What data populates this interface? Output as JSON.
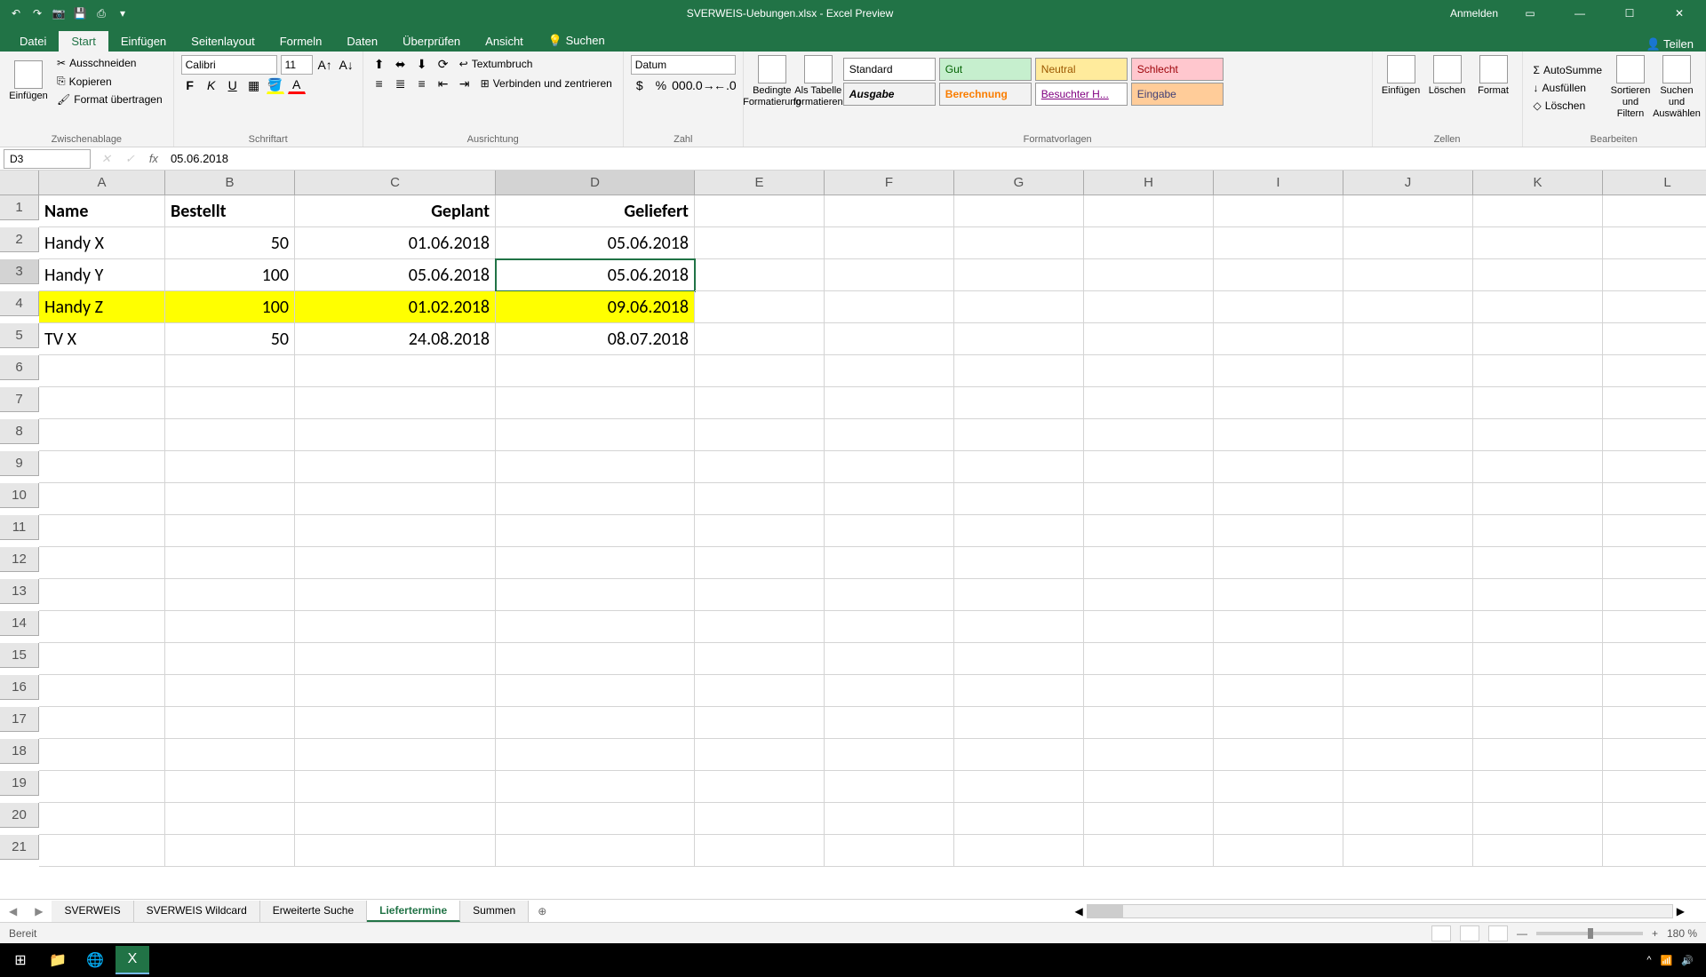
{
  "titlebar": {
    "title": "SVERWEIS-Uebungen.xlsx - Excel Preview",
    "login": "Anmelden"
  },
  "menutabs": {
    "items": [
      "Datei",
      "Start",
      "Einfügen",
      "Seitenlayout",
      "Formeln",
      "Daten",
      "Überprüfen",
      "Ansicht"
    ],
    "active": 1,
    "search": "Suchen",
    "share": "Teilen"
  },
  "ribbon": {
    "clipboard": {
      "paste": "Einfügen",
      "cut": "Ausschneiden",
      "copy": "Kopieren",
      "format_painter": "Format übertragen",
      "label": "Zwischenablage"
    },
    "font": {
      "name": "Calibri",
      "size": "11",
      "label": "Schriftart"
    },
    "alignment": {
      "wrap": "Textumbruch",
      "merge": "Verbinden und zentrieren",
      "label": "Ausrichtung"
    },
    "number": {
      "format": "Datum",
      "label": "Zahl"
    },
    "styles": {
      "cond": "Bedingte Formatierung",
      "table": "Als Tabelle formatieren",
      "standard": "Standard",
      "gut": "Gut",
      "neutral": "Neutral",
      "schlecht": "Schlecht",
      "ausgabe": "Ausgabe",
      "berechnung": "Berechnung",
      "besuchter": "Besuchter H...",
      "eingabe": "Eingabe",
      "label": "Formatvorlagen"
    },
    "cells": {
      "insert": "Einfügen",
      "delete": "Löschen",
      "format": "Format",
      "label": "Zellen"
    },
    "editing": {
      "autosum": "AutoSumme",
      "fill": "Ausfüllen",
      "clear": "Löschen",
      "sort": "Sortieren und Filtern",
      "find": "Suchen und Auswählen",
      "label": "Bearbeiten"
    }
  },
  "formulabar": {
    "namebox": "D3",
    "value": "05.06.2018"
  },
  "grid": {
    "columns": [
      "A",
      "B",
      "C",
      "D",
      "E",
      "F",
      "G",
      "H",
      "I",
      "J",
      "K",
      "L"
    ],
    "selected_col": "D",
    "selected_row": 3,
    "highlighted_row": 4,
    "headers": [
      "Name",
      "Bestellt",
      "Geplant",
      "Geliefert"
    ],
    "rows": [
      {
        "name": "Handy X",
        "bestellt": "50",
        "geplant": "01.06.2018",
        "geliefert": "05.06.2018"
      },
      {
        "name": "Handy Y",
        "bestellt": "100",
        "geplant": "05.06.2018",
        "geliefert": "05.06.2018"
      },
      {
        "name": "Handy Z",
        "bestellt": "100",
        "geplant": "01.02.2018",
        "geliefert": "09.06.2018"
      },
      {
        "name": "TV X",
        "bestellt": "50",
        "geplant": "24.08.2018",
        "geliefert": "08.07.2018"
      }
    ],
    "row_count": 21
  },
  "sheets": {
    "items": [
      "SVERWEIS",
      "SVERWEIS Wildcard",
      "Erweiterte Suche",
      "Liefertermine",
      "Summen"
    ],
    "active": 3
  },
  "statusbar": {
    "ready": "Bereit",
    "zoom": "180 %"
  }
}
